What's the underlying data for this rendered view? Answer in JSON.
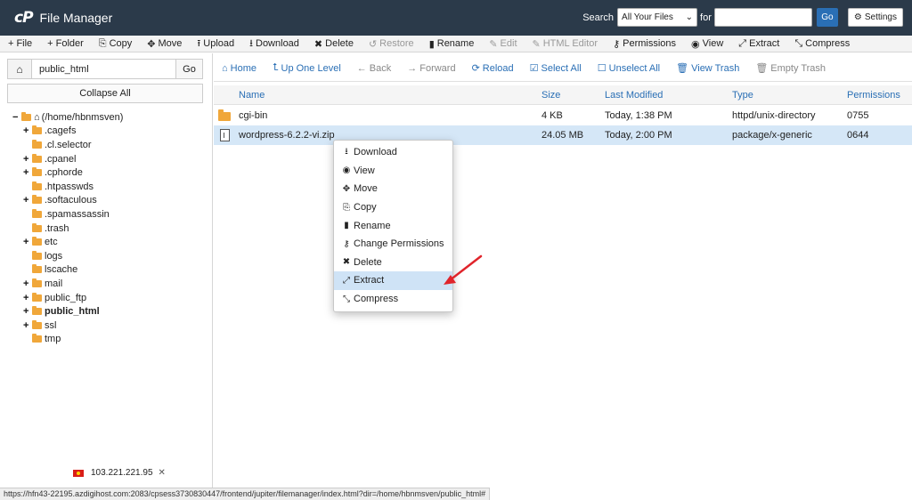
{
  "header": {
    "logo_mark": "cP",
    "title": "File Manager",
    "search_label": "Search",
    "search_scope": "All Your Files",
    "search_for_label": "for",
    "search_query": "",
    "search_go": "Go",
    "settings_label": "Settings"
  },
  "toolbar": {
    "items": [
      {
        "icon": "plus-icon",
        "glyph": "+",
        "label": "File",
        "enabled": true
      },
      {
        "icon": "plus-icon",
        "glyph": "+",
        "label": "Folder",
        "enabled": true
      },
      {
        "icon": "copy-icon",
        "glyph": "⎘",
        "label": "Copy",
        "enabled": true
      },
      {
        "icon": "move-icon",
        "glyph": "✥",
        "label": "Move",
        "enabled": true
      },
      {
        "icon": "upload-icon",
        "glyph": "⭱",
        "label": "Upload",
        "enabled": true
      },
      {
        "icon": "download-icon",
        "glyph": "⭳",
        "label": "Download",
        "enabled": true
      },
      {
        "icon": "delete-icon",
        "glyph": "✖",
        "label": "Delete",
        "enabled": true
      },
      {
        "icon": "restore-icon",
        "glyph": "↺",
        "label": "Restore",
        "enabled": false
      },
      {
        "icon": "rename-icon",
        "glyph": "▮",
        "label": "Rename",
        "enabled": true
      },
      {
        "icon": "edit-icon",
        "glyph": "✎",
        "label": "Edit",
        "enabled": false
      },
      {
        "icon": "html-editor-icon",
        "glyph": "✎",
        "label": "HTML Editor",
        "enabled": false
      },
      {
        "icon": "key-icon",
        "glyph": "⚷",
        "label": "Permissions",
        "enabled": true
      },
      {
        "icon": "eye-icon",
        "glyph": "◉",
        "label": "View",
        "enabled": true
      },
      {
        "icon": "extract-icon",
        "glyph": "⤢",
        "label": "Extract",
        "enabled": true
      },
      {
        "icon": "compress-icon",
        "glyph": "⤡",
        "label": "Compress",
        "enabled": true
      }
    ]
  },
  "sidebar": {
    "path_value": "public_html",
    "go_label": "Go",
    "collapse_label": "Collapse All",
    "root_label": "(/home/hbnmsven)",
    "tree": [
      {
        "label": ".cagefs",
        "toggle": "+",
        "bold": false
      },
      {
        "label": ".cl.selector",
        "toggle": "",
        "bold": false
      },
      {
        "label": ".cpanel",
        "toggle": "+",
        "bold": false
      },
      {
        "label": ".cphorde",
        "toggle": "+",
        "bold": false
      },
      {
        "label": ".htpasswds",
        "toggle": "",
        "bold": false
      },
      {
        "label": ".softaculous",
        "toggle": "+",
        "bold": false
      },
      {
        "label": ".spamassassin",
        "toggle": "",
        "bold": false
      },
      {
        "label": ".trash",
        "toggle": "",
        "bold": false
      },
      {
        "label": "etc",
        "toggle": "+",
        "bold": false
      },
      {
        "label": "logs",
        "toggle": "",
        "bold": false
      },
      {
        "label": "lscache",
        "toggle": "",
        "bold": false
      },
      {
        "label": "mail",
        "toggle": "+",
        "bold": false
      },
      {
        "label": "public_ftp",
        "toggle": "+",
        "bold": false
      },
      {
        "label": "public_html",
        "toggle": "+",
        "bold": true
      },
      {
        "label": "ssl",
        "toggle": "+",
        "bold": false
      },
      {
        "label": "tmp",
        "toggle": "",
        "bold": false
      }
    ],
    "ip_address": "103.221.221.95"
  },
  "status_url": "https://hfn43-22195.azdigihost.com:2083/cpsess3730830447/frontend/jupiter/filemanager/index.html?dir=/home/hbnmsven/public_html#",
  "nav": {
    "items": [
      {
        "icon": "home-icon",
        "glyph": "⌂",
        "label": "Home",
        "enabled": true
      },
      {
        "icon": "level-up-icon",
        "glyph": "⮤",
        "label": "Up One Level",
        "enabled": true
      },
      {
        "icon": "arrow-left-icon",
        "glyph": "←",
        "label": "Back",
        "enabled": false
      },
      {
        "icon": "arrow-right-icon",
        "glyph": "→",
        "label": "Forward",
        "enabled": false
      },
      {
        "icon": "reload-icon",
        "glyph": "⟳",
        "label": "Reload",
        "enabled": true
      },
      {
        "icon": "checkbox-checked-icon",
        "glyph": "☑",
        "label": "Select All",
        "enabled": true
      },
      {
        "icon": "checkbox-empty-icon",
        "glyph": "☐",
        "label": "Unselect All",
        "enabled": true
      },
      {
        "icon": "trash-icon",
        "glyph": "🗑",
        "label": "View Trash",
        "enabled": true
      },
      {
        "icon": "trash-icon",
        "glyph": "🗑",
        "label": "Empty Trash",
        "enabled": false
      }
    ]
  },
  "table": {
    "columns": [
      "Name",
      "Size",
      "Last Modified",
      "Type",
      "Permissions"
    ],
    "rows": [
      {
        "name": "cgi-bin",
        "size": "4 KB",
        "modified": "Today, 1:38 PM",
        "type": "httpd/unix-directory",
        "perms": "0755",
        "kind": "folder",
        "selected": false
      },
      {
        "name": "wordpress-6.2.2-vi.zip",
        "size": "24.05 MB",
        "modified": "Today, 2:00 PM",
        "type": "package/x-generic",
        "perms": "0644",
        "kind": "file",
        "selected": true
      }
    ]
  },
  "context_menu": {
    "items": [
      {
        "icon": "download-icon",
        "glyph": "⭳",
        "label": "Download",
        "highlight": false
      },
      {
        "icon": "eye-icon",
        "glyph": "◉",
        "label": "View",
        "highlight": false
      },
      {
        "icon": "move-icon",
        "glyph": "✥",
        "label": "Move",
        "highlight": false
      },
      {
        "icon": "copy-icon",
        "glyph": "⎘",
        "label": "Copy",
        "highlight": false
      },
      {
        "icon": "rename-icon",
        "glyph": "▮",
        "label": "Rename",
        "highlight": false
      },
      {
        "icon": "key-icon",
        "glyph": "⚷",
        "label": "Change Permissions",
        "highlight": false
      },
      {
        "icon": "delete-icon",
        "glyph": "✖",
        "label": "Delete",
        "highlight": false
      },
      {
        "icon": "extract-icon",
        "glyph": "⤢",
        "label": "Extract",
        "highlight": true
      },
      {
        "icon": "compress-icon",
        "glyph": "⤡",
        "label": "Compress",
        "highlight": false
      }
    ]
  },
  "colors": {
    "header_bg": "#2b3a4a",
    "link_blue": "#2a6fb5",
    "selected_row": "#d5e7f7",
    "annotation_arrow": "#e0242b"
  }
}
